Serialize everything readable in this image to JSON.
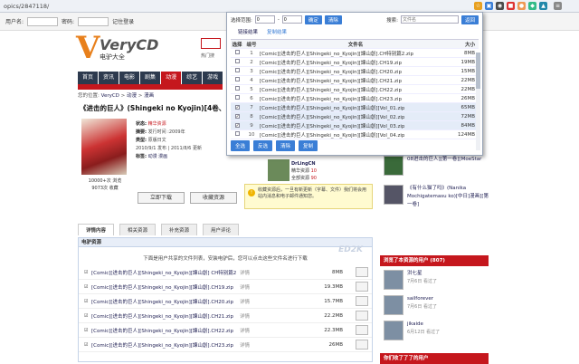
{
  "browser": {
    "url": "opics/2847118/"
  },
  "topbar": {
    "user_label": "用户名:",
    "pass_label": "密码:",
    "remember": "记住登录"
  },
  "site": {
    "logo_brand": "VeryCD",
    "logo_sub": "电驴大全",
    "logo_side": "热门搜"
  },
  "nav": {
    "items": [
      "首页",
      "资讯",
      "电影",
      "剧集",
      "动漫",
      "综艺",
      "游戏"
    ]
  },
  "crumb": {
    "prefix": "您的位置:",
    "home": "VeryCD",
    "c1": "动漫",
    "c2": "漫画"
  },
  "resource": {
    "title": "《进击的巨人》(Shingeki no Kyojin)[4卷、19-2",
    "status_label": "状态:",
    "status": "精华资源",
    "publish_label": "摘要:",
    "publish": "发行时间 :2009年",
    "type_label": "类型:",
    "type": "原版日文",
    "time": "2010/9/1 发布 | 2011/8/6 更新",
    "tag_label": "标签:",
    "tags": "动漫 漫画",
    "votes1": "10000+次 浏览",
    "votes2": "9073次 收藏",
    "download_btn": "立即下载",
    "fav_btn": "收藏资源"
  },
  "poster": {
    "name": "DrLingCN",
    "line1": "精华资源",
    "count1": "10",
    "line2": "全部资源",
    "count2": "90"
  },
  "tip": {
    "text": "收藏资源后，一旦有新更新（字幕、文件）我们将会用站内消息和电子邮件通知您。"
  },
  "tabs": [
    "详情内容",
    "相关资源",
    "补充资源",
    "用户评论"
  ],
  "files": {
    "header": "电驴资源",
    "watermark": "ED2K",
    "note": "下面是用户共享的文件列表，安装电驴后，您可以点击这些文件名进行下载",
    "detail": "详情",
    "rows": [
      {
        "name": "[Comic][进击的巨人][Shingeki_no_Kyojin][諫山創] CH特别篇2.zip",
        "size": "8MB"
      },
      {
        "name": "[Comic][进击的巨人][Shingeki_no_Kyojin][諫山創].CH19.zip",
        "size": "19.3MB"
      },
      {
        "name": "[Comic][进击的巨人][Shingeki_no_Kyojin][諫山創].CH20.zip",
        "size": "15.7MB"
      },
      {
        "name": "[Comic][进击的巨人][Shingeki_no_Kyojin][諫山創].CH21.zip",
        "size": "22.2MB"
      },
      {
        "name": "[Comic][进击的巨人][Shingeki_no_Kyojin][諫山創].CH22.zip",
        "size": "22.3MB"
      },
      {
        "name": "[Comic][进击的巨人][Shingeki_no_Kyojin][諫山創].CH23.zip",
        "size": "26MB"
      }
    ]
  },
  "sidebar": {
    "top_items": [
      "08进击的巨人][第一卷][MoeStar",
      "[漫画]",
      "《有什么猫了吗》(Nanika Mochigatemasu ko)[中日]漫画][第一卷]"
    ],
    "users_header": "浏览了本资源的用户 (807)",
    "users": [
      {
        "name": "洪七星",
        "time": "7月6日 看过了"
      },
      {
        "name": "sailforever",
        "time": "7月6日 看过了"
      },
      {
        "name": "jikaide",
        "time": "6月12日 看过了"
      }
    ],
    "bottom_header": "你们收了了了的用户"
  },
  "popup": {
    "range_label": "选择范围:",
    "range_from": "0",
    "range_to": "0",
    "confirm": "确定",
    "clear": "清除",
    "search_label": "搜索:",
    "search_placeholder": "文件名",
    "back": "返回",
    "tab_links": "链接结果",
    "tab_copy": "复制结果",
    "col_select": "选择",
    "col_no": "编号",
    "col_name": "文件名",
    "col_size": "大小",
    "rows": [
      {
        "no": "1",
        "name": "[Comic][进击的巨人][Shingeki_no_Kyojin][諫山創].CH特别篇2.zip",
        "size": "8MB",
        "checked": false
      },
      {
        "no": "2",
        "name": "[Comic][进击的巨人][Shingeki_no_Kyojin][諫山創].CH19.zip",
        "size": "19MB",
        "checked": false
      },
      {
        "no": "3",
        "name": "[Comic][进击的巨人][Shingeki_no_Kyojin][諫山創].CH20.zip",
        "size": "15MB",
        "checked": false
      },
      {
        "no": "4",
        "name": "[Comic][进击的巨人][Shingeki_no_Kyojin][諫山創].CH21.zip",
        "size": "22MB",
        "checked": false
      },
      {
        "no": "5",
        "name": "[Comic][进击的巨人][Shingeki_no_Kyojin][諫山創].CH22.zip",
        "size": "22MB",
        "checked": false
      },
      {
        "no": "6",
        "name": "[Comic][进击的巨人][Shingeki_no_Kyojin][諫山創].CH23.zip",
        "size": "26MB",
        "checked": false
      },
      {
        "no": "7",
        "name": "[Comic][进击的巨人][Shingeki_no_Kyojin][諫山創][Vol_01.zip",
        "size": "65MB",
        "checked": true
      },
      {
        "no": "8",
        "name": "[Comic][进击的巨人][Shingeki_no_Kyojin][諫山創][Vol_02.zip",
        "size": "72MB",
        "checked": true
      },
      {
        "no": "9",
        "name": "[Comic][进击的巨人][Shingeki_no_Kyojin][諫山創][Vol_03.zip",
        "size": "84MB",
        "checked": true
      },
      {
        "no": "10",
        "name": "[Comic][进击的巨人][Shingeki_no_Kyojin][諫山創][Vol_04.zip",
        "size": "124MB",
        "checked": false
      }
    ],
    "btn_all": "全选",
    "btn_invert": "反选",
    "btn_clear": "清除",
    "btn_copy": "复制"
  }
}
